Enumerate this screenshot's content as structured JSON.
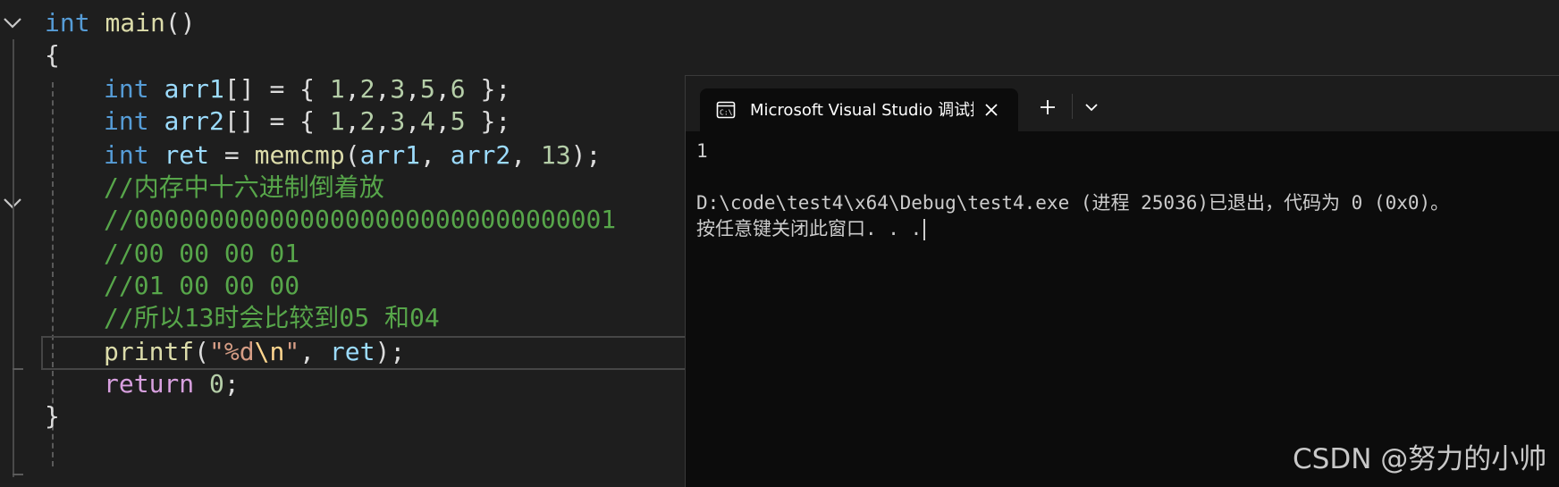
{
  "editor": {
    "lines": [
      [
        [
          "kw",
          "int"
        ],
        [
          "pun",
          " "
        ],
        [
          "fn",
          "main"
        ],
        [
          "pun",
          "()"
        ]
      ],
      [
        [
          "pun",
          "{"
        ]
      ],
      [
        [
          "kw",
          "int"
        ],
        [
          "pun",
          " "
        ],
        [
          "var",
          "arr1"
        ],
        [
          "pun",
          "[] = { "
        ],
        [
          "num",
          "1"
        ],
        [
          "pun",
          ","
        ],
        [
          "num",
          "2"
        ],
        [
          "pun",
          ","
        ],
        [
          "num",
          "3"
        ],
        [
          "pun",
          ","
        ],
        [
          "num",
          "5"
        ],
        [
          "pun",
          ","
        ],
        [
          "num",
          "6"
        ],
        [
          "pun",
          " };"
        ]
      ],
      [
        [
          "kw",
          "int"
        ],
        [
          "pun",
          " "
        ],
        [
          "var",
          "arr2"
        ],
        [
          "pun",
          "[] = { "
        ],
        [
          "num",
          "1"
        ],
        [
          "pun",
          ","
        ],
        [
          "num",
          "2"
        ],
        [
          "pun",
          ","
        ],
        [
          "num",
          "3"
        ],
        [
          "pun",
          ","
        ],
        [
          "num",
          "4"
        ],
        [
          "pun",
          ","
        ],
        [
          "num",
          "5"
        ],
        [
          "pun",
          " };"
        ]
      ],
      [
        [
          "kw",
          "int"
        ],
        [
          "pun",
          " "
        ],
        [
          "var",
          "ret"
        ],
        [
          "pun",
          " = "
        ],
        [
          "fn",
          "memcmp"
        ],
        [
          "pun",
          "("
        ],
        [
          "var",
          "arr1"
        ],
        [
          "pun",
          ", "
        ],
        [
          "var",
          "arr2"
        ],
        [
          "pun",
          ", "
        ],
        [
          "num",
          "13"
        ],
        [
          "pun",
          ");"
        ]
      ],
      [
        [
          "cm",
          "//内存中十六进制倒着放"
        ]
      ],
      [
        [
          "cm",
          "//00000000000000000000000000000001"
        ]
      ],
      [
        [
          "cm",
          "//00 00 00 01"
        ]
      ],
      [
        [
          "cm",
          "//01 00 00 00"
        ]
      ],
      [
        [
          "cm",
          "//所以13时会比较到05 和04"
        ]
      ],
      [
        [
          "fn",
          "printf"
        ],
        [
          "pun",
          "("
        ],
        [
          "str",
          "\"%d"
        ],
        [
          "esc",
          "\\n"
        ],
        [
          "str",
          "\""
        ],
        [
          "pun",
          ", "
        ],
        [
          "var",
          "ret"
        ],
        [
          "pun",
          ");"
        ]
      ],
      [
        [
          "ret",
          "return"
        ],
        [
          "pun",
          " "
        ],
        [
          "num",
          "0"
        ],
        [
          "pun",
          ";"
        ]
      ],
      [
        [
          "pun",
          "}"
        ]
      ]
    ]
  },
  "terminal": {
    "tab_title": "Microsoft Visual Studio 调试控制台",
    "output": [
      "1",
      "",
      "D:\\code\\test4\\x64\\Debug\\test4.exe (进程 25036)已退出，代码为 0 (0x0)。",
      "按任意键关闭此窗口. . ."
    ]
  },
  "watermark": "CSDN @努力的小帅",
  "colors": {
    "editor_bg": "#1e1e1e",
    "terminal_bg": "#0c0c0c",
    "keyword": "#569cd6",
    "function": "#dcdcaa",
    "variable": "#9cdcfe",
    "number": "#b5cea8",
    "comment": "#57a64a",
    "string": "#d69d85",
    "control_keyword": "#d8a0df"
  },
  "icons": {
    "fold": "chevron-down-icon",
    "terminal_tab": "console-icon",
    "close": "close-icon",
    "new_tab": "plus-icon",
    "dropdown": "chevron-down-icon"
  }
}
